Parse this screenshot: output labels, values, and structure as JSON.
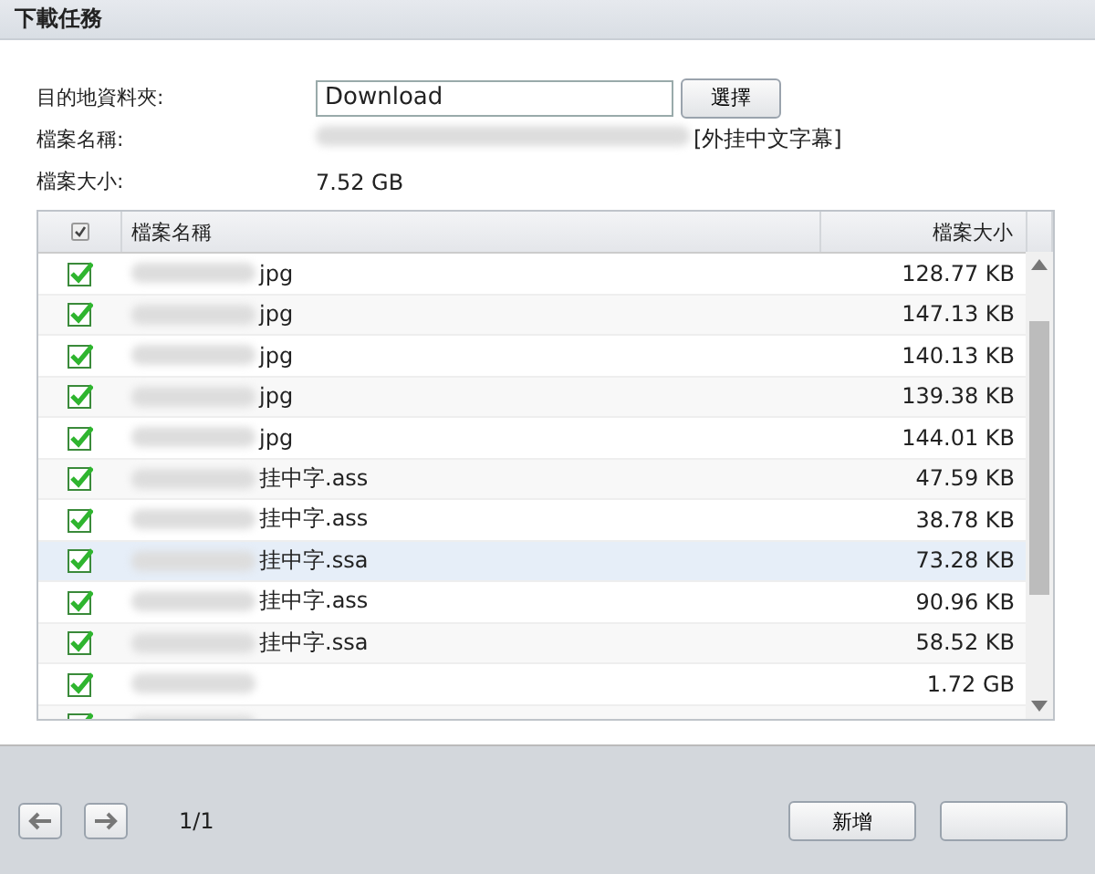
{
  "window": {
    "title": "下載任務"
  },
  "form": {
    "folder_label": "目的地資料夾:",
    "folder_value": "Download",
    "choose_button": "選擇",
    "name_label": "檔案名稱:",
    "name_value": "[外挂中文字幕]",
    "size_label": "檔案大小:",
    "size_value": "7.52 GB"
  },
  "table": {
    "columns": [
      {
        "kind": "check",
        "checked": true
      },
      {
        "label": "檔案名稱",
        "kind": "name"
      },
      {
        "label": "檔案大小",
        "kind": "size"
      }
    ],
    "rows": [
      {
        "checked": true,
        "selected": false,
        "name": "jpg",
        "size": "128.77 KB"
      },
      {
        "checked": true,
        "selected": false,
        "name": "jpg",
        "size": "147.13 KB"
      },
      {
        "checked": true,
        "selected": false,
        "name": "jpg",
        "size": "140.13 KB"
      },
      {
        "checked": true,
        "selected": false,
        "name": "jpg",
        "size": "139.38 KB"
      },
      {
        "checked": true,
        "selected": false,
        "name": "jpg",
        "size": "144.01 KB"
      },
      {
        "checked": true,
        "selected": false,
        "name": "挂中字.ass",
        "size": "47.59 KB"
      },
      {
        "checked": true,
        "selected": false,
        "name": "挂中字.ass",
        "size": "38.78 KB"
      },
      {
        "checked": true,
        "selected": true,
        "name": "挂中字.ssa",
        "size": "73.28 KB"
      },
      {
        "checked": true,
        "selected": false,
        "name": "挂中字.ass",
        "size": "90.96 KB"
      },
      {
        "checked": true,
        "selected": false,
        "name": "挂中字.ssa",
        "size": "58.52 KB"
      },
      {
        "checked": true,
        "selected": false,
        "name": "",
        "size": "1.72 GB"
      },
      {
        "checked": true,
        "selected": false,
        "name": "",
        "size": ""
      }
    ]
  },
  "footer": {
    "page": "1/1",
    "buttons": [
      {
        "kind": "labeled",
        "label": "新增"
      },
      {
        "kind": "blank"
      }
    ]
  }
}
